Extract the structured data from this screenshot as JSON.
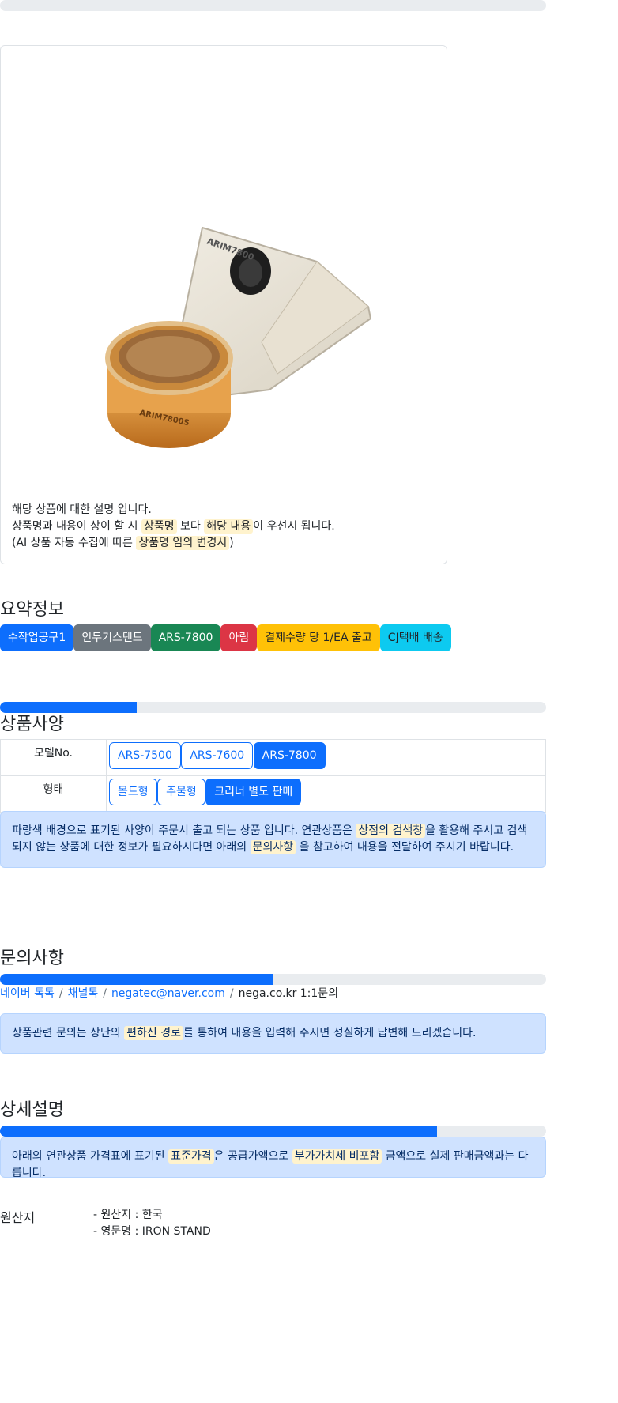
{
  "product_card": {
    "image": {
      "brand_label": "ARIM7800",
      "base_label": "ARIM7800S"
    },
    "desc_line1": "해당 상품에 대한 설명 입니다.",
    "desc_line2_a": "상품명과 내용이 상이 할 시 ",
    "desc_line2_hl1": "상품명",
    "desc_line2_b": " 보다 ",
    "desc_line2_hl2": "해당 내용",
    "desc_line2_c": "이 우선시 됩니다.",
    "desc_line3_a": "(AI 상품 자동 수집에 따른 ",
    "desc_line3_hl": "상품명 임의 변경시",
    "desc_line3_b": ")"
  },
  "summary": {
    "title": "요약정보",
    "badges": [
      {
        "label": "수작업공구1",
        "color": "#0d6efd"
      },
      {
        "label": "인두기스탠드",
        "color": "#6c757d"
      },
      {
        "label": "ARS-7800",
        "color": "#198754"
      },
      {
        "label": "아림",
        "color": "#dc3545"
      },
      {
        "label": "결제수량 당 1/EA 출고",
        "color": "#ffc107"
      },
      {
        "label": "CJ택배 배송",
        "color": "#0dcaf0"
      }
    ]
  },
  "spec": {
    "title": "상품사양",
    "progress": 0.25,
    "rows": [
      {
        "label": "모델No.",
        "options": [
          {
            "label": "ARS-7500",
            "selected": false
          },
          {
            "label": "ARS-7600",
            "selected": false
          },
          {
            "label": "ARS-7800",
            "selected": true
          }
        ]
      },
      {
        "label": "형태",
        "options": [
          {
            "label": "몰드형",
            "selected": false
          },
          {
            "label": "주물형",
            "selected": false
          },
          {
            "label": "크리너 별도 판매",
            "selected": true
          }
        ]
      }
    ],
    "notice_a": "파랑색 배경으로 표기된 사양이 주문시 출고 되는 상품 입니다. 연관상품은 ",
    "notice_hl1": "상점의 검색창",
    "notice_b": "을 활용해 주시고 검색되지 않는 상품에 대한 정보가 필요하시다면 아래의 ",
    "notice_hl2": "문의사항",
    "notice_c": " 을 참고하여 내용을 전달하여 주시기 바랍니다."
  },
  "inquiry": {
    "title": "문의사항",
    "progress": 0.5,
    "links": [
      "네이버 톡톡",
      "채널톡",
      "negatec@naver.com"
    ],
    "plain": "nega.co.kr 1:1문의",
    "separator": "/",
    "notice_a": "상품관련 문의는 상단의 ",
    "notice_hl": "편하신 경로",
    "notice_b": "를 통하여 내용을 입력해 주시면 성실하게 답변해 드리겠습니다."
  },
  "detail": {
    "title": "상세설명",
    "progress": 0.8,
    "notice_a": "아래의 연관상품 가격표에 표기된 ",
    "notice_hl1": "표준가격",
    "notice_b": "은 공급가액으로 ",
    "notice_hl2": "부가가치세 비포함",
    "notice_c": " 금액으로 실제 판매금액과는 다릅니다."
  },
  "origin": {
    "label": "원산지",
    "values": [
      "- 원산지 : 한국",
      "- 영문명 : IRON STAND"
    ]
  }
}
